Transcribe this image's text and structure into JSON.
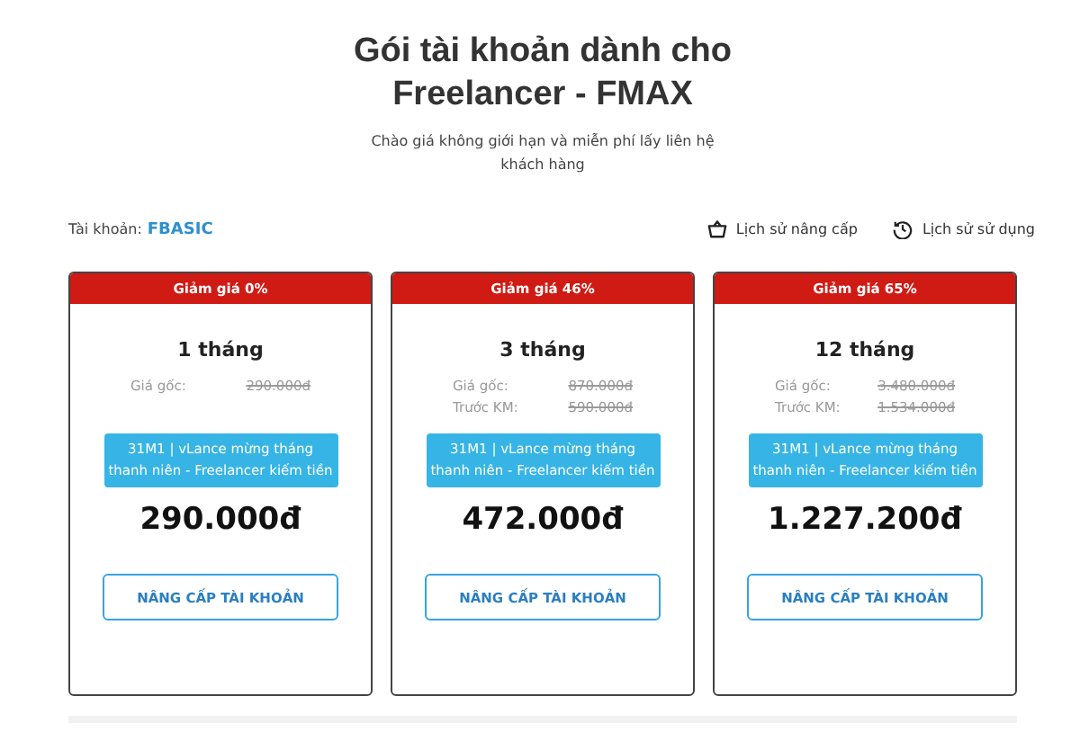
{
  "header": {
    "title": "Gói tài khoản dành cho Freelancer - FMAX",
    "subtitle": "Chào giá không giới hạn và miễn phí lấy liên hệ khách hàng"
  },
  "account": {
    "label": "Tài khoản:",
    "value": "FBASIC"
  },
  "links": [
    {
      "kind": "basket",
      "label": "Lịch sử nâng cấp"
    },
    {
      "kind": "history",
      "label": "Lịch sử sử dụng"
    }
  ],
  "plans": [
    {
      "discount": "Giảm giá 0%",
      "duration": "1 tháng",
      "price_rows": [
        {
          "label": "Giá gốc:",
          "value": "290.000đ"
        }
      ],
      "promo": "31M1 | vLance mừng tháng thanh niên - Freelancer kiếm tiền",
      "price": "290.000đ",
      "button": "NÂNG CẤP TÀI KHOẢN"
    },
    {
      "discount": "Giảm giá 46%",
      "duration": "3 tháng",
      "price_rows": [
        {
          "label": "Giá gốc:",
          "value": "870.000đ"
        },
        {
          "label": "Trước KM:",
          "value": "590.000đ"
        }
      ],
      "promo": "31M1 | vLance mừng tháng thanh niên - Freelancer kiếm tiền",
      "price": "472.000đ",
      "button": "NÂNG CẤP TÀI KHOẢN"
    },
    {
      "discount": "Giảm giá 65%",
      "duration": "12 tháng",
      "price_rows": [
        {
          "label": "Giá gốc:",
          "value": "3.480.000đ"
        },
        {
          "label": "Trước KM:",
          "value": "1.534.000đ"
        }
      ],
      "promo": "31M1 | vLance mừng tháng thanh niên - Freelancer kiếm tiền",
      "price": "1.227.200đ",
      "button": "NÂNG CẤP TÀI KHOẢN"
    }
  ]
}
